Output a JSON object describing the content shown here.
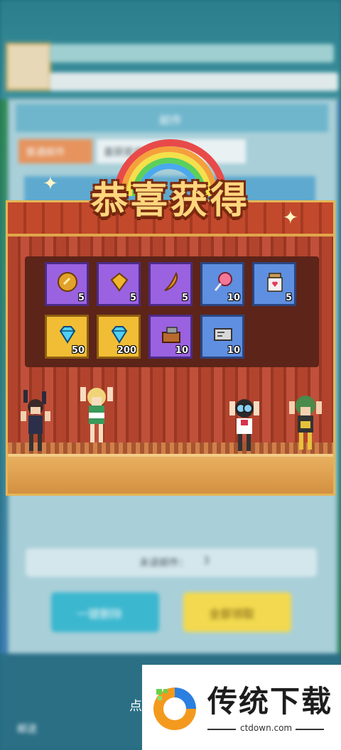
{
  "background": {
    "panel_title": "邮件",
    "mail_tab": "普通邮件",
    "mail_tab2": "喜获奖金全员报告",
    "mail_count_label": "未读邮件：",
    "mail_count_value": "3",
    "delete_all_label": "一键删除",
    "collect_all_label": "全部领取",
    "footer_hint": "点",
    "footer_left_label": "邮送"
  },
  "modal": {
    "title": "恭喜获得",
    "items": [
      {
        "icon": "gold-medal-icon",
        "bg": "purple",
        "qty": "5"
      },
      {
        "icon": "gold-gem-icon",
        "bg": "purple",
        "qty": "5"
      },
      {
        "icon": "horn-icon",
        "bg": "purple",
        "qty": "5"
      },
      {
        "icon": "lollipop-icon",
        "bg": "blue",
        "qty": "10"
      },
      {
        "icon": "potion-jar-icon",
        "bg": "blue",
        "qty": "5"
      },
      {
        "icon": "diamond-icon",
        "bg": "gold",
        "qty": "50"
      },
      {
        "icon": "diamond-icon",
        "bg": "gold",
        "qty": "200"
      },
      {
        "icon": "toolbox-icon",
        "bg": "purple",
        "qty": "10"
      },
      {
        "icon": "ticket-icon",
        "bg": "blue",
        "qty": "10"
      }
    ]
  },
  "watermark": {
    "title": "传统下载",
    "url": "ctdown.com"
  },
  "colors": {
    "stage_red": "#b2442e",
    "title_yellow": "#ffd67d",
    "slot_purple": "#9a62e0",
    "slot_blue": "#5f8fe0",
    "slot_gold": "#f1bd35"
  }
}
